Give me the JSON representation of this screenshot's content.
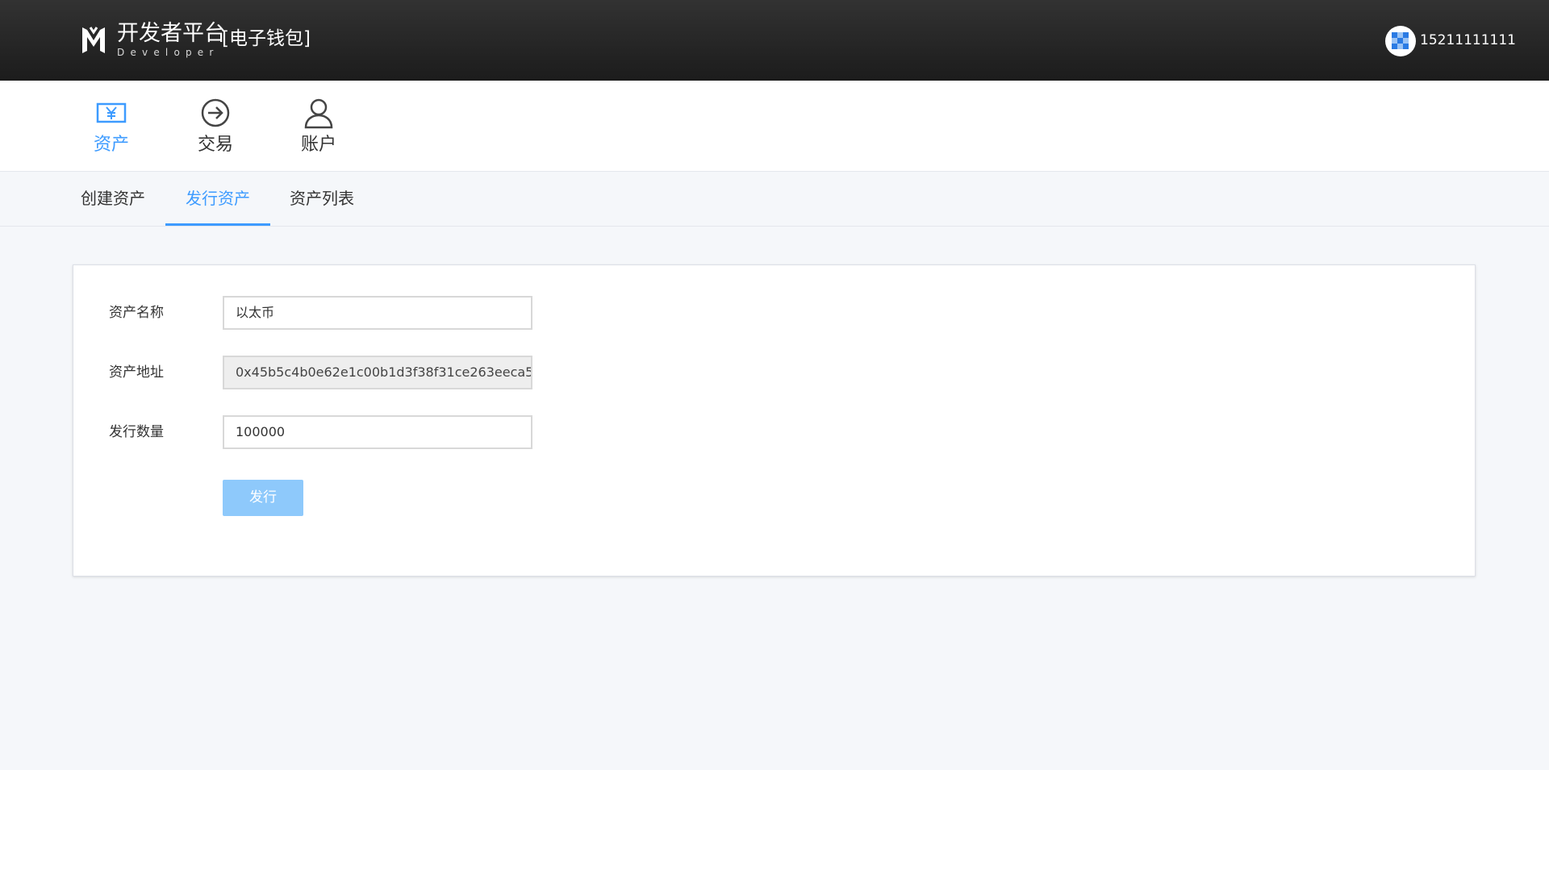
{
  "header": {
    "brand_title": "开发者平台",
    "brand_subtitle": "Developer",
    "brand_tag": "[电子钱包]",
    "username": "15211111111"
  },
  "topnav": {
    "items": [
      {
        "label": "资产",
        "icon": "yen-icon",
        "active": true
      },
      {
        "label": "交易",
        "icon": "arrow-circle-icon",
        "active": false
      },
      {
        "label": "账户",
        "icon": "user-icon",
        "active": false
      }
    ]
  },
  "subtabs": {
    "items": [
      {
        "label": "创建资产",
        "active": false
      },
      {
        "label": "发行资产",
        "active": true
      },
      {
        "label": "资产列表",
        "active": false
      }
    ]
  },
  "form": {
    "asset_name_label": "资产名称",
    "asset_name_value": "以太币",
    "asset_address_label": "资产地址",
    "asset_address_value": "0x45b5c4b0e62e1c00b1d3f38f31ce263eeca5",
    "issue_amount_label": "发行数量",
    "issue_amount_value": "100000",
    "submit_label": "发行"
  },
  "colors": {
    "accent": "#3d9bff",
    "button": "#8ec9fb",
    "header_bg": "#262626",
    "page_bg": "#f5f7fa"
  }
}
